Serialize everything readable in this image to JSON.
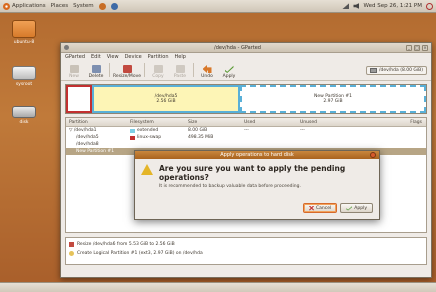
{
  "panel": {
    "menus": [
      "Applications",
      "Places",
      "System"
    ],
    "clock": "Wed Sep 26,  1:21 PM"
  },
  "desktop": {
    "icons": [
      {
        "label": "ubuntu-8"
      },
      {
        "label": "sysroot"
      },
      {
        "label": "disk"
      }
    ]
  },
  "window": {
    "title": "/dev/hda - GParted",
    "controls": [
      "_",
      "□",
      "×"
    ],
    "menus": [
      "GParted",
      "Edit",
      "View",
      "Device",
      "Partition",
      "Help"
    ],
    "toolbar": {
      "new": "New",
      "delete": "Delete",
      "resize": "Resize/Move",
      "copy": "Copy",
      "paste": "Paste",
      "undo": "Undo",
      "apply": "Apply"
    },
    "device_select": "/dev/hda  (8.00 GiB)",
    "disk_graphic": {
      "b_name": "/dev/hda5",
      "b_size": "2.56 GiB",
      "c_name": "New Partition #1",
      "c_size": "2.97 GiB"
    },
    "columns": [
      "Partition",
      "Filesystem",
      "Size",
      "Used",
      "Unused",
      "Flags"
    ],
    "rows": [
      {
        "partition": "▽ /dev/hda1",
        "fs": "extended",
        "fs_color": "#7ecfe6",
        "size": "8.00 GiB",
        "used": "---",
        "unused": "---",
        "flags": ""
      },
      {
        "partition": "/dev/hda5",
        "fs": "linux-swap",
        "fs_color": "#c23030",
        "size": "498.35 MiB",
        "used": "",
        "unused": "",
        "flags": ""
      },
      {
        "partition": "/dev/hda8",
        "fs": "",
        "fs_color": "",
        "size": "",
        "used": "",
        "unused": "",
        "flags": ""
      },
      {
        "partition": "New Partition #1",
        "fs": "",
        "fs_color": "",
        "size": "",
        "used": "",
        "unused": "",
        "flags": ""
      }
    ],
    "operations": [
      "Resize /dev/hda6 from 5.53 GiB to 2.56 GiB",
      "Create Logical Partition #1 (ext3, 2.97 GiB) on /dev/hda"
    ]
  },
  "dialog": {
    "title": "Apply operations to hard disk",
    "main": "Are you sure you want to apply the pending operations?",
    "sub": "It is recommended to backup valuable data before proceeding.",
    "cancel": "Cancel",
    "apply": "Apply"
  }
}
